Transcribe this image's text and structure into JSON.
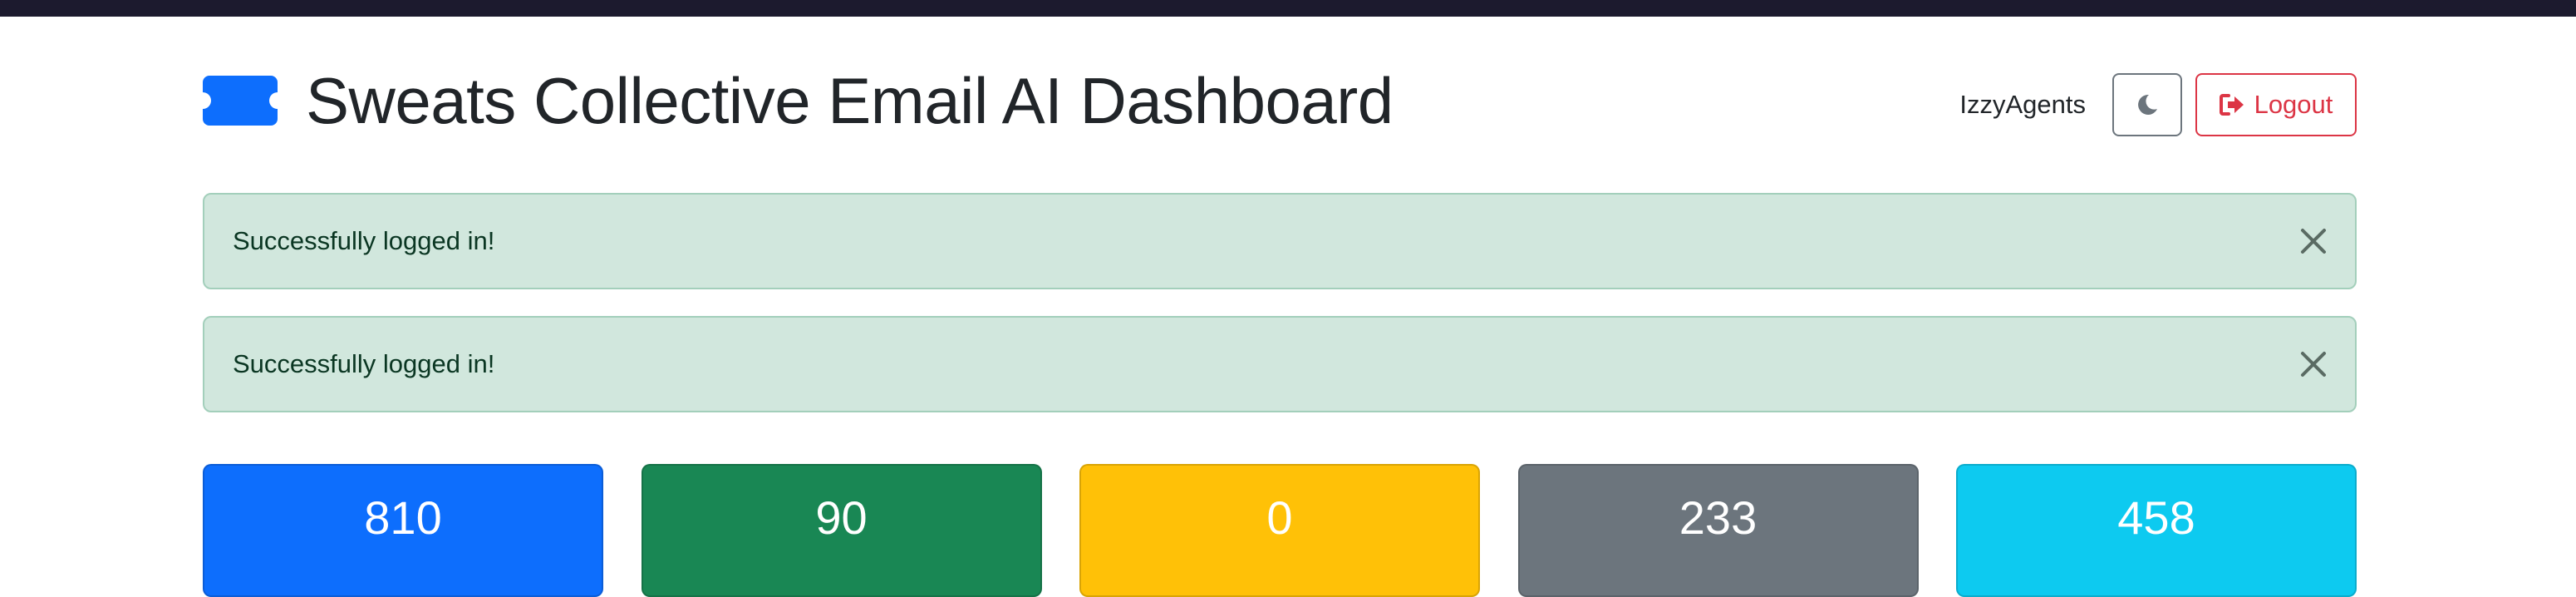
{
  "header": {
    "title": "Sweats Collective Email AI Dashboard",
    "icon": "ticket-icon",
    "username": "IzzyAgents",
    "theme_toggle_icon": "moon-icon",
    "logout_icon": "sign-out-icon",
    "logout_label": "Logout"
  },
  "alerts": [
    {
      "message": "Successfully logged in!",
      "close_icon": "close-icon"
    },
    {
      "message": "Successfully logged in!",
      "close_icon": "close-icon"
    }
  ],
  "stats": [
    {
      "value": "810",
      "color": "#0d6efd"
    },
    {
      "value": "90",
      "color": "#198754"
    },
    {
      "value": "0",
      "color": "#ffc107"
    },
    {
      "value": "233",
      "color": "#6c757d"
    },
    {
      "value": "458",
      "color": "#0dcaf0"
    }
  ],
  "colors": {
    "primary": "#0d6efd",
    "success_bg": "#d1e7dd",
    "success_text": "#0a3622",
    "danger": "#dc3545",
    "secondary": "#6c757d",
    "top_bar": "#1c1a2e"
  }
}
